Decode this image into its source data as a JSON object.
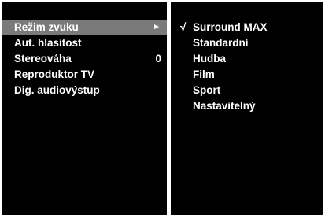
{
  "menu": {
    "items": [
      {
        "label": "Režim zvuku",
        "value": "",
        "selected": true,
        "submenu_arrow": "►"
      },
      {
        "label": "Aut. hlasitost",
        "value": "",
        "selected": false
      },
      {
        "label": "Stereováha",
        "value": "0",
        "selected": false
      },
      {
        "label": "Reproduktor TV",
        "value": "",
        "selected": false
      },
      {
        "label": "Dig. audiovýstup",
        "value": "",
        "selected": false
      }
    ]
  },
  "submenu": {
    "check_mark": "√",
    "options": [
      {
        "label": "Surround MAX",
        "checked": true
      },
      {
        "label": "Standardní",
        "checked": false
      },
      {
        "label": "Hudba",
        "checked": false
      },
      {
        "label": "Film",
        "checked": false
      },
      {
        "label": "Sport",
        "checked": false
      },
      {
        "label": "Nastavitelný",
        "checked": false
      }
    ]
  },
  "colors": {
    "panel_background": "#000000",
    "text": "#ffffff",
    "selection_highlight": "#7a7a7a",
    "frame": "#ffffff"
  }
}
